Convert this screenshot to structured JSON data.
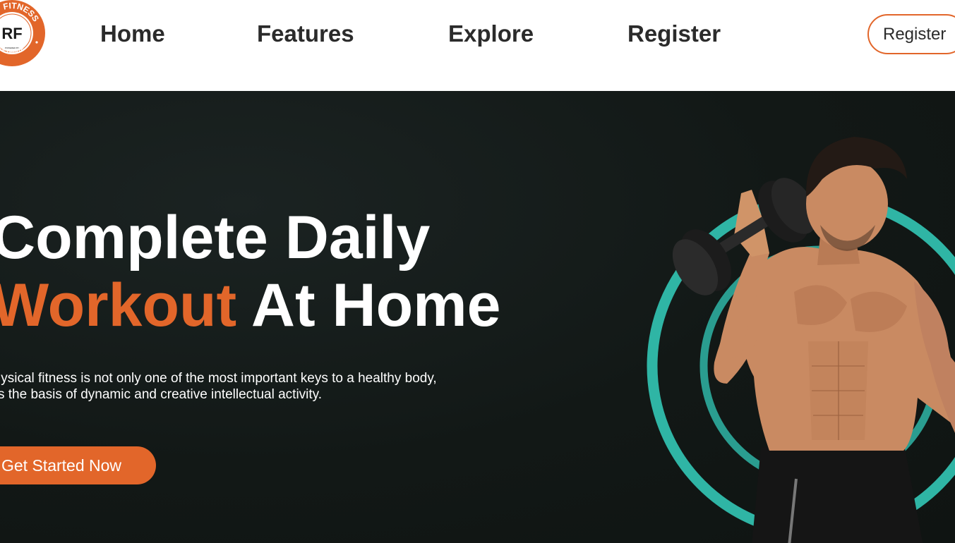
{
  "brand": {
    "ring_text": "ENT FITNESS",
    "monogram": "RF",
    "bottom_text": "ULTIMATE",
    "tagline": "POWERED BY"
  },
  "nav": {
    "items": [
      {
        "label": "Home"
      },
      {
        "label": "Features"
      },
      {
        "label": "Explore"
      },
      {
        "label": "Register"
      }
    ],
    "register_button": "Register"
  },
  "hero": {
    "title_line1": "Complete Daily",
    "title_accent": "Workout",
    "title_rest": " At Home",
    "subtitle_line1": "Physical fitness is not only one of the most important keys to a healthy body,",
    "subtitle_line2": "it is the basis of dynamic and creative intellectual activity.",
    "cta": "Get Started Now",
    "image_alt": "muscular-man-with-dumbbell"
  },
  "colors": {
    "accent": "#e2662a",
    "ring": "#2fb5a5",
    "hero_bg": "#121816",
    "text_dark": "#2b2b2b"
  }
}
